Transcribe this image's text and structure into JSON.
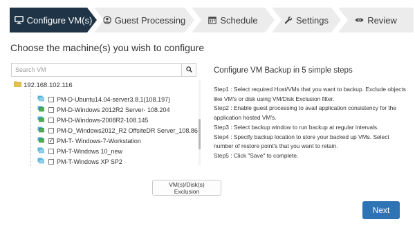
{
  "wizard": {
    "steps": [
      {
        "label": "Configure VM(s)",
        "icon": "monitor-icon",
        "active": true
      },
      {
        "label": "Guest Processing",
        "icon": "user-circle-icon",
        "active": false
      },
      {
        "label": "Schedule",
        "icon": "calendar-icon",
        "active": false
      },
      {
        "label": "Settings",
        "icon": "wrench-icon",
        "active": false
      },
      {
        "label": "Review",
        "icon": "eye-icon",
        "active": false
      }
    ]
  },
  "page": {
    "title": "Choose the machine(s) you wish to configure"
  },
  "search": {
    "placeholder": "Search VM",
    "icon": "search-icon"
  },
  "tree": {
    "root": {
      "label": "192.168.102.116",
      "icon": "folder-icon"
    },
    "vms": [
      {
        "label": "PM-D-Ubuntu14.04-server3.8.1(108.197)",
        "checked": false
      },
      {
        "label": "PM-D-Windows 2012R2 Server- 108.204",
        "checked": false
      },
      {
        "label": "PM-D-Windows-2008R2-108.145",
        "checked": false
      },
      {
        "label": "PM-D_Windows2012_R2 OffsiteDR Server_108.86",
        "checked": false
      },
      {
        "label": "PM-T- Windows-7-Workstation",
        "checked": true
      },
      {
        "label": "PM-T-Windows 10_new",
        "checked": false
      },
      {
        "label": "PM-T-Windows XP SP2",
        "checked": false
      }
    ]
  },
  "instructions": {
    "title": "Configure VM Backup in 5 simple steps",
    "lines": [
      "Step1 : Select required Host/VMs that you want to backup. Exclude objects like VM's or disk using VM/Disk Exclusion filter.",
      "Step2 : Enable guest processing to avail application consistency for the application hosted VM's.",
      "Step3 : Select backup window to run backup at regular intervals.",
      "Step4 : Specify backup location to store your backed up VMs. Select number of restore point's that you want to retain.",
      "Step5 : Click \"Save\" to complete."
    ]
  },
  "buttons": {
    "exclusion": "VM(s)/Disk(s) Exclusion",
    "next": "Next"
  },
  "colors": {
    "active_step": "#1f3446",
    "inactive_step": "#ececec",
    "primary_button": "#2e74b5",
    "vm_icon_on": "#4caf50",
    "vm_icon_off": "#4fb3d9"
  }
}
